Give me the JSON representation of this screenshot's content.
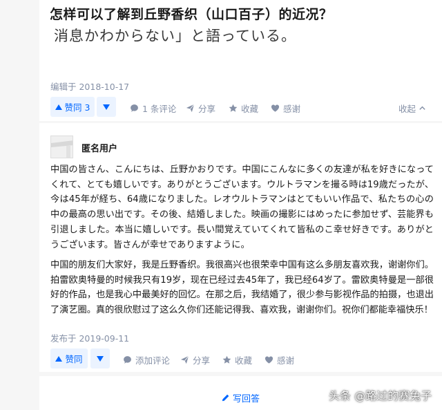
{
  "question": {
    "title": "怎样可以了解到丘野香织（山口百子）的近况？",
    "quote_fragment": "消息かわからない」と語っている。"
  },
  "first_answer_footer": {
    "edited_date": "编辑于 2018-10-17",
    "vote_up_label": "赞同 3",
    "comments_label": "1 条评论",
    "share_label": "分享",
    "favorite_label": "收藏",
    "thanks_label": "感谢",
    "collapse_label": "收起"
  },
  "answer": {
    "author": "匿名用户",
    "paragraph_jp": "中国の皆さん、こんにちは、丘野かおりです。中国にこんなに多くの友達が私を好きになってくれて、とても嬉しいです。ありがとうございます。ウルトラマンを撮る時は19歳だったが、今は45年が経ち、64歳になりました。レオウルトラマンはとてもいい作品で、私たちの心の中の最高の思い出です。その後、結婚しました。映画の撮影にはめったに参加せず、芸能界も引退しました。本当に嬉しいです。長い間覚えていてくれて皆私のこ幸せ好きです。ありがとうございます。皆さんが幸せでありますように。",
    "paragraph_cn": "中国的朋友们大家好，我是丘野香织。我很高兴也很荣幸中国有这么多朋友喜欢我，谢谢你们。拍雷欧奥特曼的时候我只有19岁，现在已经过去45年了，我已经64岁了。雷欧奥特曼是一部很好的作品，也是我心中最美好的回忆。在那之后，我结婚了，很少参与影视作品的拍摄，也退出了演艺圈。真的很欣慰过了这么久你们还能记得我、喜欢我，谢谢你们。祝你们都能幸福快乐！",
    "published_date": "发布于 2019-09-11",
    "vote_up_label": "赞同",
    "add_comment_label": "添加评论",
    "share_label": "分享",
    "favorite_label": "收藏",
    "thanks_label": "感谢"
  },
  "write_answer_label": "写回答",
  "watermark": "头条 @路过的赛兔子",
  "colors": {
    "accent": "#0066ff",
    "vote_bg": "#ebf3ff",
    "meta_gray": "#8590a6",
    "page_bg": "#f6f6f6"
  },
  "icons": [
    "comment-icon",
    "share-icon",
    "star-icon",
    "heart-icon",
    "chevron-up-icon",
    "pencil-icon",
    "triangle-up-icon",
    "triangle-down-icon"
  ]
}
